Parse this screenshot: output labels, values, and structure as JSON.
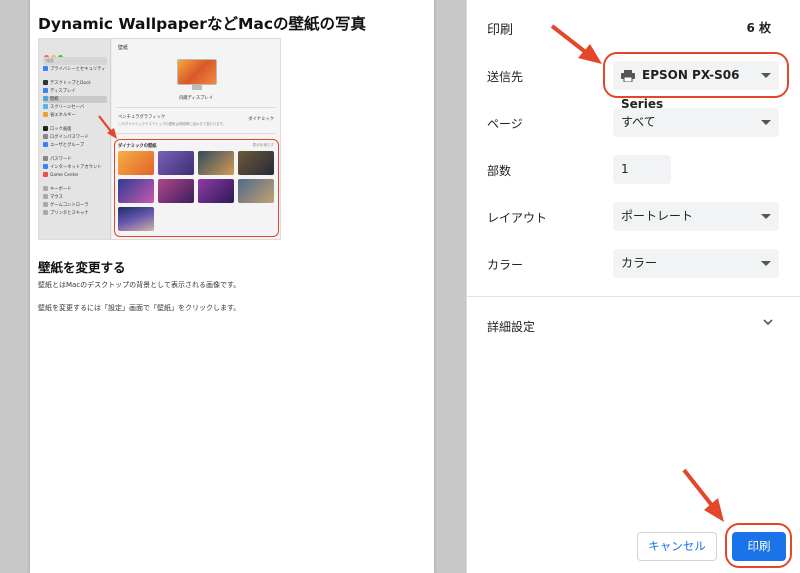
{
  "preview": {
    "title": "Dynamic WallpaperなどMacの壁紙の写真",
    "heading": "壁紙を変更する",
    "paragraph1": "壁紙とはMacのデスクトップの背景として表示される画像です。",
    "paragraph2": "壁紙を変更するには「設定」画面で「壁紙」をクリックします。",
    "screenshot": {
      "search_placeholder": "検索",
      "sidebar_items": [
        "プライバシーとセキュリティ",
        "デスクトップとDock",
        "ディスプレイ",
        "壁紙",
        "スクリーンセーバ",
        "省エネルギー",
        "ロック画面",
        "ログインパスワード",
        "ユーザとグループ",
        "パスワード",
        "インターネットアカウント",
        "Game Center",
        "キーボード",
        "マウス",
        "ゲームコントローラ",
        "プリンタとスキャナ"
      ],
      "header": "壁紙",
      "display_name": "内蔵ディスプレイ",
      "option_label": "ベンチュラグラフィック",
      "option_desc": "このダイナミックデスクトップの壁紙は時間帯に合わせて変わります。",
      "option_value": "ダイナミック",
      "section_label": "ダイナミックの壁紙",
      "section_more": "表示を減らす"
    }
  },
  "print": {
    "title": "印刷",
    "sheet_count": "6 枚",
    "destination_label": "送信先",
    "destination_value": "EPSON PX-S06 Series",
    "pages_label": "ページ",
    "pages_value": "すべて",
    "copies_label": "部数",
    "copies_value": "1",
    "layout_label": "レイアウト",
    "layout_value": "ポートレート",
    "color_label": "カラー",
    "color_value": "カラー",
    "advanced_label": "詳細設定",
    "cancel_label": "キャンセル",
    "print_label": "印刷"
  },
  "colors": {
    "accent": "#1a73e8",
    "highlight": "#e2472a"
  }
}
